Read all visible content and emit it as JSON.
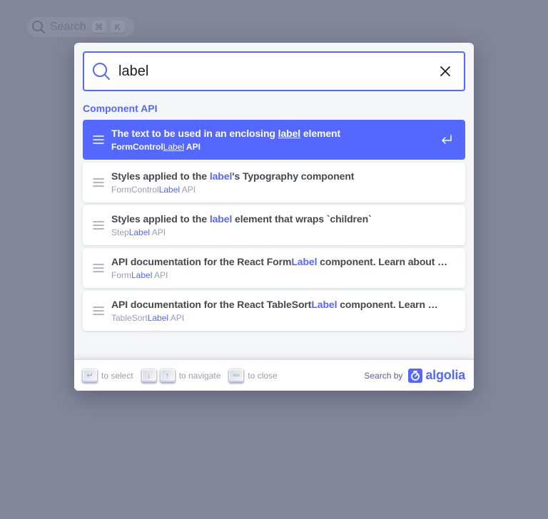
{
  "background_search": {
    "label": "Search",
    "keys": [
      "⌘",
      "K"
    ]
  },
  "search": {
    "value": "label",
    "placeholder": "Search"
  },
  "section": {
    "title": "Component API"
  },
  "hits": [
    {
      "title_parts": [
        "The text to be used in an enclosing ",
        "label",
        " element"
      ],
      "path_parts": [
        "FormControl",
        "Label",
        " API"
      ],
      "active": true
    },
    {
      "title_parts": [
        "Styles applied to the ",
        "label",
        "'s Typography component"
      ],
      "path_parts": [
        "FormControl",
        "Label",
        " API"
      ],
      "active": false
    },
    {
      "title_parts": [
        "Styles applied to the ",
        "label",
        " element that wraps `children`"
      ],
      "path_parts": [
        "Step",
        "Label",
        " API"
      ],
      "active": false
    },
    {
      "title_parts": [
        "API documentation for the React Form",
        "Label",
        " component. Learn about …"
      ],
      "path_parts": [
        "Form",
        "Label",
        " API"
      ],
      "active": false
    },
    {
      "title_parts": [
        "API documentation for the React TableSort",
        "Label",
        " component. Learn …"
      ],
      "path_parts": [
        "TableSort",
        "Label",
        " API"
      ],
      "active": false
    }
  ],
  "footer": {
    "select_key": "↵",
    "select_text": "to select",
    "nav_keys": [
      "↓",
      "↑"
    ],
    "nav_text": "to navigate",
    "close_key": "esc",
    "close_text": "to close",
    "search_by": "Search by",
    "brand": "algolia"
  },
  "colors": {
    "accent": "#5468ff",
    "overlay": "#828798"
  }
}
